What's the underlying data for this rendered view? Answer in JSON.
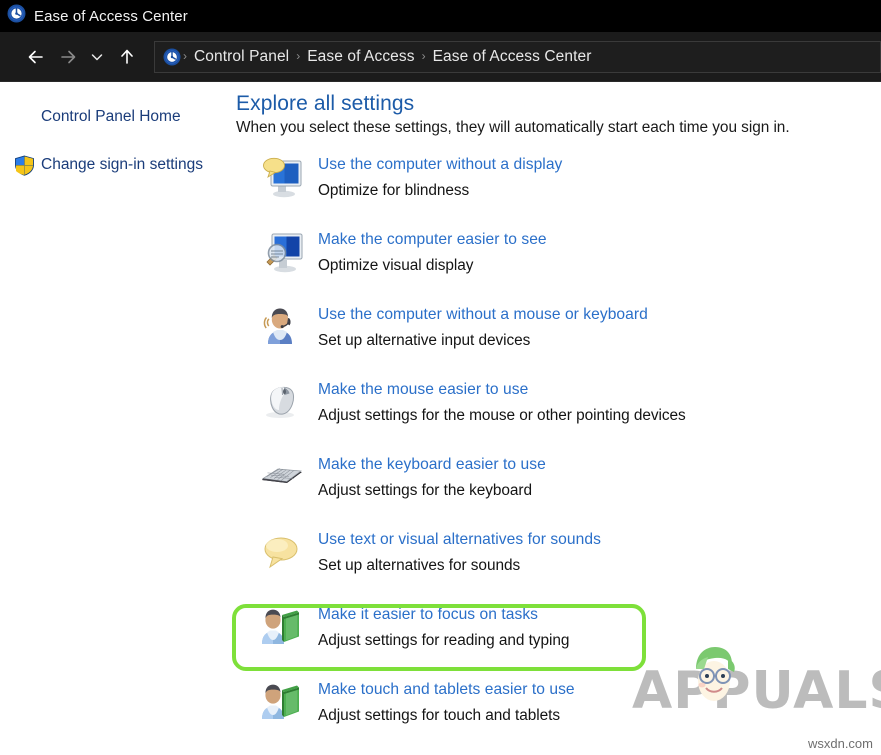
{
  "window": {
    "title": "Ease of Access Center",
    "title_icon": "ease-of-access-icon"
  },
  "navigation": {
    "back_icon": "back-arrow-icon",
    "forward_icon": "forward-arrow-icon",
    "recent_icon": "chevron-down-icon",
    "up_icon": "up-arrow-icon",
    "address_icon": "ease-of-access-icon",
    "breadcrumbs": [
      {
        "label": "Control Panel"
      },
      {
        "label": "Ease of Access"
      },
      {
        "label": "Ease of Access Center"
      }
    ],
    "separator": "›"
  },
  "sidebar": {
    "items": [
      {
        "label": "Control Panel Home",
        "icon": "none"
      },
      {
        "label": "Change sign-in settings",
        "icon": "uac-shield-icon"
      }
    ]
  },
  "main": {
    "title": "Explore all settings",
    "subtitle": "When you select these settings, they will automatically start each time you sign in.",
    "settings": [
      {
        "link": "Use the computer without a display",
        "desc": "Optimize for blindness",
        "icon": "monitor-narrator-icon"
      },
      {
        "link": "Make the computer easier to see",
        "desc": "Optimize visual display",
        "icon": "monitor-magnifier-icon"
      },
      {
        "link": "Use the computer without a mouse or keyboard",
        "desc": "Set up alternative input devices",
        "icon": "person-speech-icon"
      },
      {
        "link": "Make the mouse easier to use",
        "desc": "Adjust settings for the mouse or other pointing devices",
        "icon": "mouse-icon"
      },
      {
        "link": "Make the keyboard easier to use",
        "desc": "Adjust settings for the keyboard",
        "icon": "keyboard-icon"
      },
      {
        "link": "Use text or visual alternatives for sounds",
        "desc": "Set up alternatives for sounds",
        "icon": "speech-bubble-icon"
      },
      {
        "link": "Make it easier to focus on tasks",
        "desc": "Adjust settings for reading and typing",
        "icon": "person-book-icon",
        "highlighted": true
      },
      {
        "link": "Make touch and tablets easier to use",
        "desc": "Adjust settings for touch and tablets",
        "icon": "person-book-icon"
      }
    ]
  },
  "annotations": {
    "highlight_color": "#7ee03a",
    "highlight_target": "Make it easier to focus on tasks"
  },
  "watermarks": {
    "brand": "APPUALS",
    "brand_color": "#bcbcbc",
    "site": "wsxdn.com"
  }
}
